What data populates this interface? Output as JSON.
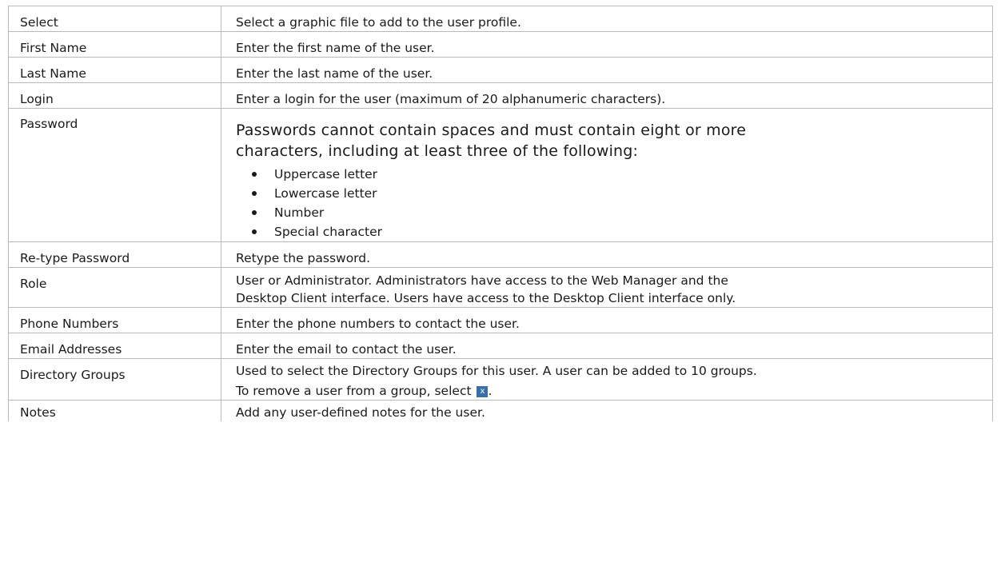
{
  "rows": [
    {
      "field": "Select",
      "description": "Select a graphic file to add to the user profile."
    },
    {
      "field": "First Name",
      "description": "Enter the first name of the user."
    },
    {
      "field": "Last Name",
      "description": "Enter the last name of the user."
    },
    {
      "field": "Login",
      "description": "Enter a login for the user (maximum of 20 alphanumeric characters)."
    },
    {
      "field": "Password",
      "intro_line1": "Passwords cannot contain spaces and must contain eight or more",
      "intro_line2": "characters, including at least three of the following:",
      "bullets": [
        "Uppercase letter",
        "Lowercase letter",
        "Number",
        "Special character"
      ]
    },
    {
      "field": "Re-type Password",
      "description": "Retype the password."
    },
    {
      "field": "Role",
      "line1": "User or Administrator. Administrators have access to the Web Manager and the",
      "line2": "Desktop Client interface. Users have access to the Desktop Client interface only."
    },
    {
      "field": "Phone Numbers",
      "description": "Enter the phone numbers to contact the user."
    },
    {
      "field": "Email Addresses",
      "description": "Enter the email to contact the user."
    },
    {
      "field": "Directory Groups",
      "line1": "Used to select the Directory Groups for this user. A user can be added to 10 groups.",
      "line2_before": "To remove a user from a group, select",
      "icon": "close-icon",
      "icon_glyph": "x",
      "line2_after": "."
    },
    {
      "field": "Notes",
      "description": "Add any user-defined notes for the user."
    }
  ]
}
